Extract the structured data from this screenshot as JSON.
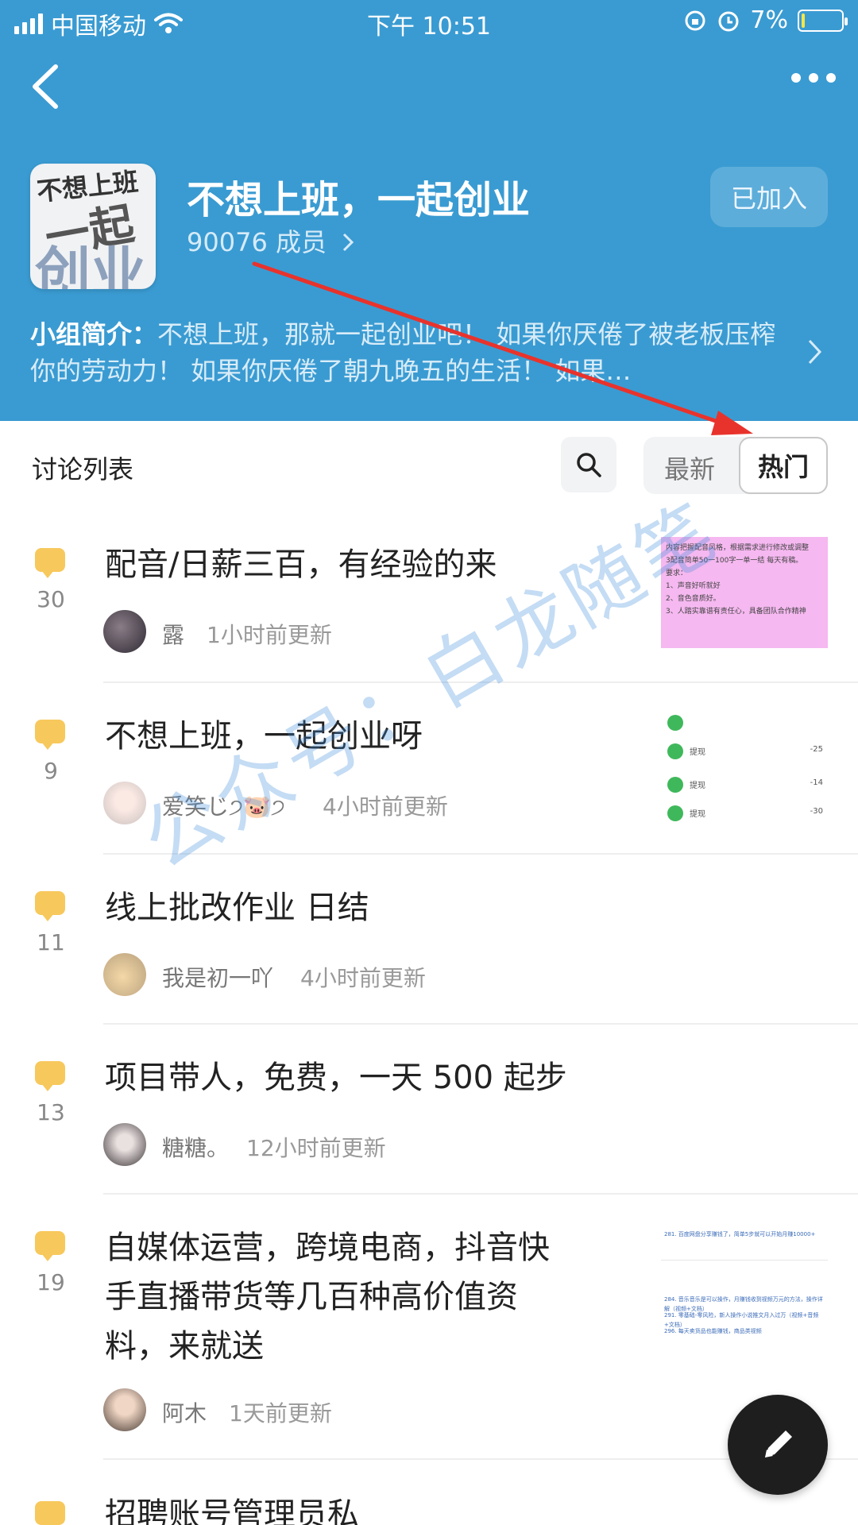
{
  "status_bar": {
    "carrier": "中国移动",
    "time": "下午 10:51",
    "battery": "7%",
    "battery_level": 0.07
  },
  "nav": {
    "back_icon": "chevron-left-icon",
    "more_icon": "more-horizontal-icon"
  },
  "group": {
    "logo_line1": "不想上班",
    "logo_line2": "一起",
    "logo_line3": "创业",
    "title": "不想上班，一起创业",
    "members": "90076 成员",
    "joined_label": "已加入",
    "intro_label": "小组简介：",
    "intro_text": "不想上班，那就一起创业吧！ 如果你厌倦了被老板压榨你的劳动力！ 如果你厌倦了朝九晚五的生活！ 如果…"
  },
  "list": {
    "title": "讨论列表",
    "sort_newest": "最新",
    "sort_hot": "热门",
    "posts": [
      {
        "comments": "30",
        "title": "配音/日薪三百，有经验的来",
        "author": "露",
        "time": "1小时前更新",
        "has_thumb": true
      },
      {
        "comments": "9",
        "title": "不想上班，一起创业呀",
        "author": "爱笑じ੭🐷੭",
        "time": "4小时前更新",
        "has_thumb": true
      },
      {
        "comments": "11",
        "title": "线上批改作业 日结",
        "author": "我是初一吖",
        "time": "4小时前更新",
        "has_thumb": false
      },
      {
        "comments": "13",
        "title": "项目带人，免费，一天 500 起步",
        "author": "糖糖。",
        "time": "12小时前更新",
        "has_thumb": false
      },
      {
        "comments": "19",
        "title_lines": [
          "自媒体运营，跨境电商，抖音快",
          "手直播带货等几百种高价值资",
          "料，来就送"
        ],
        "author": "阿木",
        "time": "1天前更新",
        "has_thumb": true
      },
      {
        "comments": "",
        "title": "招聘账号管理员私",
        "author": "",
        "time": "",
        "has_thumb": false
      }
    ]
  },
  "thumb_text": {
    "t1_lines": [
      "内容把握配音风格，根据需求进行修改或调整",
      "3配音简单50一100字一单一结 每天有稿。",
      "要求：",
      "1、声音好听就好",
      "2、音色音质好。",
      "3、人踏实靠谱有责任心，具备团队合作精神"
    ],
    "t2_rows": [
      [
        "提现",
        "-25"
      ],
      [
        "提现",
        "-14"
      ],
      [
        "提现",
        "-30"
      ]
    ],
    "t5_lines": [
      "281. 百度网盘分享赚钱了，简单5步就可以开始月赚10000+",
      "284. 音乐音乐是可以操作，月赚钱收到视频万元的方法，操作详解（视频+文档）",
      "291. 零基础-零风险，新人操作小说推文月入过万（视频+音频+文档）",
      "296. 每天卖货品也能赚钱，商品类视频"
    ]
  },
  "watermark": "公众号：白龙随笔",
  "colors": {
    "header_bg": "#3a9bd2",
    "comment_icon": "#f7c85c",
    "arrow": "#e8332c"
  }
}
